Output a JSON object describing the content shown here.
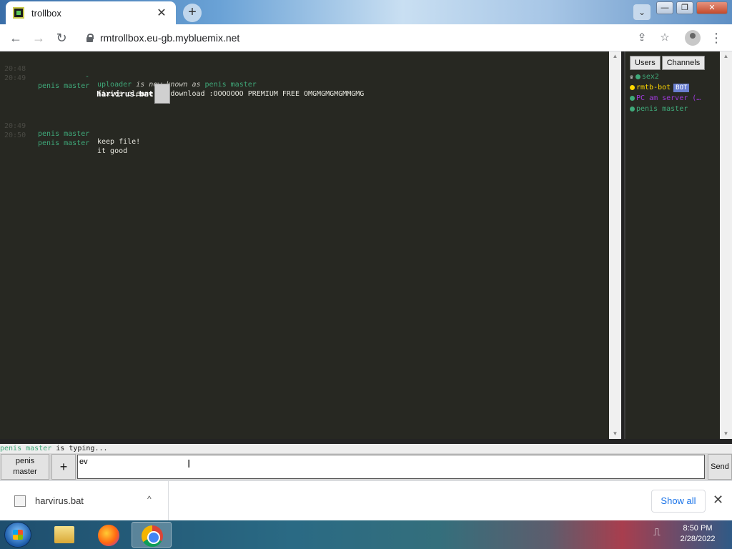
{
  "browser": {
    "tab": {
      "title": "trollbox",
      "close": "✕"
    },
    "new_tab": "+",
    "tab_search": "⌄",
    "window": {
      "minimize": "—",
      "maximize": "❐",
      "close": "✕"
    },
    "nav": {
      "back": "←",
      "forward": "→",
      "reload": "↻"
    },
    "url": "rmtrollbox.eu-gb.mybluemix.net",
    "share": "⇪",
    "bookmark": "☆",
    "menu": "⋮"
  },
  "chat": {
    "system_message": {
      "time": "20:48",
      "dash": "-",
      "old_nick": "uploader",
      "text": " is now known as ",
      "new_nick": "penis master"
    },
    "messages": [
      {
        "time": "20:49",
        "nick": "penis master",
        "text": "fixies cleaner!! download :OOOOOOO PREMIUM FREE OMGMGMGMGMMGMG"
      },
      {
        "time": "20:49",
        "nick": "penis master",
        "text": "keep file!"
      },
      {
        "time": "20:50",
        "nick": "penis master",
        "text": "it good"
      }
    ],
    "file": {
      "name": "harvirus.bat"
    }
  },
  "sidebar": {
    "tabs": [
      "Users",
      "Channels"
    ],
    "users": [
      {
        "name": "sex2",
        "color": "#3fa97a",
        "dot": "#3fa97a",
        "crown": "♛"
      },
      {
        "name": "rmtb-bot",
        "color": "#ffd700",
        "dot": "#ffd700",
        "badge": "BOT"
      },
      {
        "name": "PC am server (…",
        "color": "#a03adc",
        "dot": "#3fa97a"
      },
      {
        "name": "penis master",
        "color": "#3fa97a",
        "dot": "#3fa97a"
      }
    ]
  },
  "typing": {
    "nick": "penis master",
    "text": " is typing..."
  },
  "input": {
    "nick_line1": "penis",
    "nick_line2": "master",
    "plus": "+",
    "value": "ev",
    "send": "Send"
  },
  "downloads": {
    "file": "harvirus.bat",
    "chevron": "^",
    "show_all": "Show all",
    "close": "✕"
  },
  "taskbar": {
    "time": "8:50 PM",
    "date": "2/28/2022",
    "tray_icon": "⎍"
  }
}
